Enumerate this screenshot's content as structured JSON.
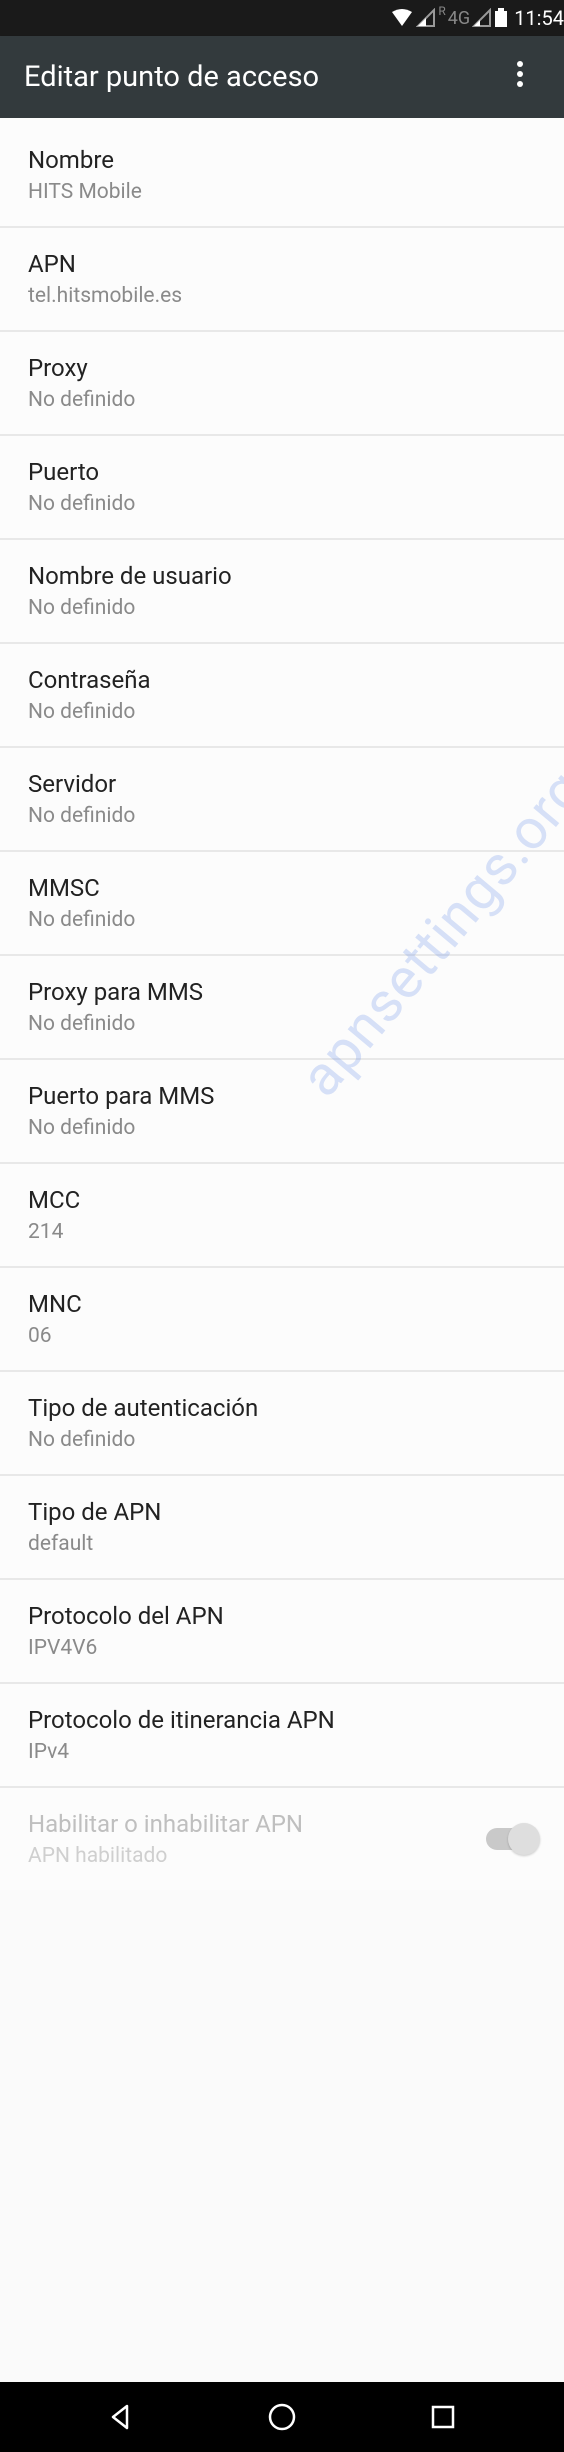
{
  "status": {
    "network_label": "4G",
    "roaming_label": "R",
    "time": "11:54"
  },
  "appbar": {
    "title": "Editar punto de acceso"
  },
  "rows": [
    {
      "label": "Nombre",
      "value": "HITS Mobile"
    },
    {
      "label": "APN",
      "value": "tel.hitsmobile.es"
    },
    {
      "label": "Proxy",
      "value": "No definido"
    },
    {
      "label": "Puerto",
      "value": "No definido"
    },
    {
      "label": "Nombre de usuario",
      "value": "No definido"
    },
    {
      "label": "Contraseña",
      "value": "No definido"
    },
    {
      "label": "Servidor",
      "value": "No definido"
    },
    {
      "label": "MMSC",
      "value": "No definido"
    },
    {
      "label": "Proxy para MMS",
      "value": "No definido"
    },
    {
      "label": "Puerto para MMS",
      "value": "No definido"
    },
    {
      "label": "MCC",
      "value": "214"
    },
    {
      "label": "MNC",
      "value": "06"
    },
    {
      "label": "Tipo de autenticación",
      "value": "No definido"
    },
    {
      "label": "Tipo de APN",
      "value": "default"
    },
    {
      "label": "Protocolo del APN",
      "value": "IPV4V6"
    },
    {
      "label": "Protocolo de itinerancia APN",
      "value": "IPv4"
    }
  ],
  "toggle": {
    "label": "Habilitar o inhabilitar APN",
    "value": "APN habilitado"
  },
  "watermark": "apnsettings.org"
}
